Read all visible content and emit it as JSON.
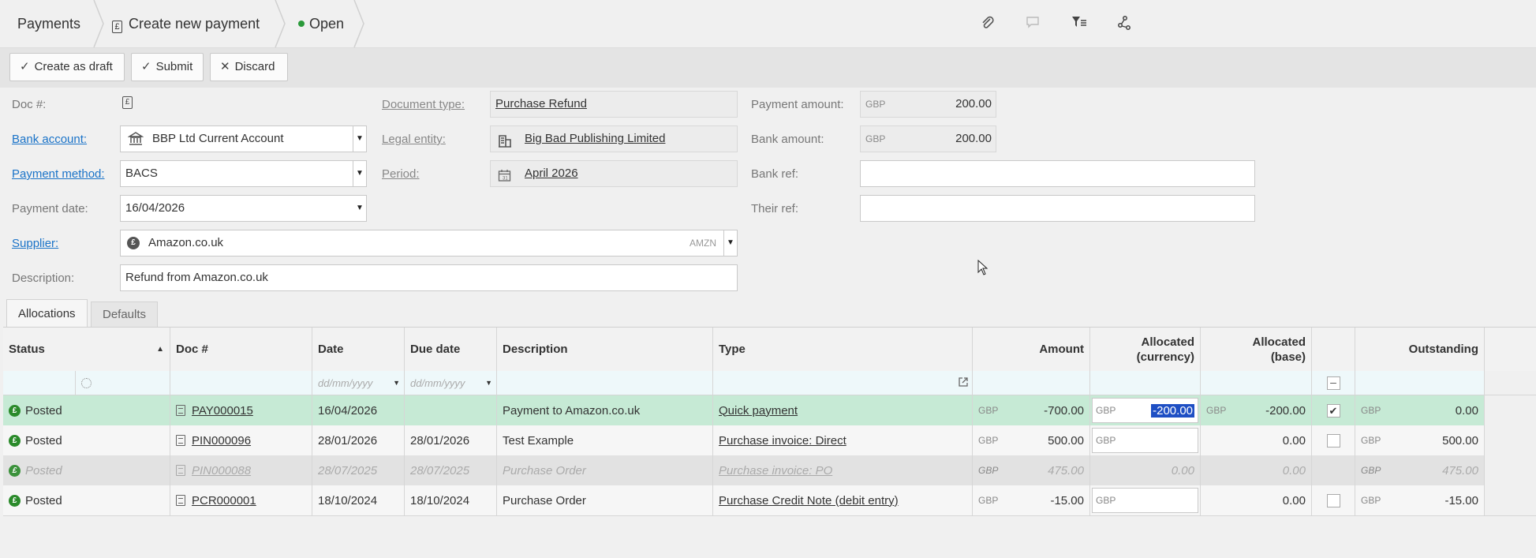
{
  "breadcrumb": {
    "root": "Payments",
    "current": "Create new payment",
    "status": "Open"
  },
  "toolbar_icons": [
    "paperclip-icon",
    "comment-icon",
    "filter-list-icon",
    "share-icon"
  ],
  "actions": {
    "create_draft": "Create as draft",
    "submit": "Submit",
    "discard": "Discard"
  },
  "form": {
    "doc_no_label": "Doc #:",
    "bank_account_label": "Bank account:",
    "bank_account_value": "BBP Ltd Current Account",
    "payment_method_label": "Payment method:",
    "payment_method_value": "BACS",
    "payment_date_label": "Payment date:",
    "payment_date_value": "16/04/2026",
    "supplier_label": "Supplier:",
    "supplier_value": "Amazon.co.uk",
    "supplier_code": "AMZN",
    "description_label": "Description:",
    "description_value": "Refund from Amazon.co.uk",
    "document_type_label": "Document type:",
    "document_type_value": "Purchase Refund",
    "legal_entity_label": "Legal entity:",
    "legal_entity_value": "Big Bad Publishing Limited",
    "period_label": "Period:",
    "period_value": "April 2026",
    "payment_amount_label": "Payment amount:",
    "payment_amount_currency": "GBP",
    "payment_amount_value": "200.00",
    "bank_amount_label": "Bank amount:",
    "bank_amount_currency": "GBP",
    "bank_amount_value": "200.00",
    "bank_ref_label": "Bank ref:",
    "bank_ref_value": "",
    "their_ref_label": "Their ref:",
    "their_ref_value": ""
  },
  "tabs": [
    "Allocations",
    "Defaults"
  ],
  "grid": {
    "headers": {
      "status": "Status",
      "doc": "Doc #",
      "date": "Date",
      "due": "Due date",
      "description": "Description",
      "type": "Type",
      "amount": "Amount",
      "alloc_cur_1": "Allocated",
      "alloc_cur_2": "(currency)",
      "alloc_base_1": "Allocated",
      "alloc_base_2": "(base)",
      "outstanding": "Outstanding"
    },
    "filter_placeholder_date": "dd/mm/yyyy",
    "filter_placeholder_due": "dd/mm/yyyy",
    "rows": [
      {
        "status": "Posted",
        "doc": "PAY000015",
        "date": "16/04/2026",
        "due": "",
        "description": "Payment to Amazon.co.uk",
        "type": "Quick payment",
        "amount_cur": "GBP",
        "amount": "-700.00",
        "alloc_cur": "GBP",
        "alloc_value": "-200.00",
        "alloc_base_cur": "GBP",
        "alloc_base": "-200.00",
        "checked": true,
        "out_cur": "GBP",
        "outstanding": "0.00"
      },
      {
        "status": "Posted",
        "doc": "PIN000096",
        "date": "28/01/2026",
        "due": "28/01/2026",
        "description": "Test Example",
        "type": "Purchase invoice: Direct",
        "amount_cur": "GBP",
        "amount": "500.00",
        "alloc_cur": "GBP",
        "alloc_value": "",
        "alloc_base_cur": "",
        "alloc_base": "0.00",
        "checked": false,
        "out_cur": "GBP",
        "outstanding": "500.00"
      },
      {
        "status": "Posted",
        "doc": "PIN000088",
        "date": "28/07/2025",
        "due": "28/07/2025",
        "description": "Purchase Order",
        "type": "Purchase invoice: PO",
        "amount_cur": "GBP",
        "amount": "475.00",
        "alloc_cur": "",
        "alloc_value": "0.00",
        "alloc_base_cur": "",
        "alloc_base": "0.00",
        "checked": false,
        "out_cur": "GBP",
        "outstanding": "475.00"
      },
      {
        "status": "Posted",
        "doc": "PCR000001",
        "date": "18/10/2024",
        "due": "18/10/2024",
        "description": "Purchase Order",
        "type": "Purchase Credit Note (debit entry)",
        "amount_cur": "GBP",
        "amount": "-15.00",
        "alloc_cur": "GBP",
        "alloc_value": "",
        "alloc_base_cur": "",
        "alloc_base": "0.00",
        "checked": false,
        "out_cur": "GBP",
        "outstanding": "-15.00"
      }
    ]
  },
  "colors": {
    "selected_row": "#c6ead5",
    "posted_icon": "#2a8a2a",
    "link": "#1a73c8"
  }
}
